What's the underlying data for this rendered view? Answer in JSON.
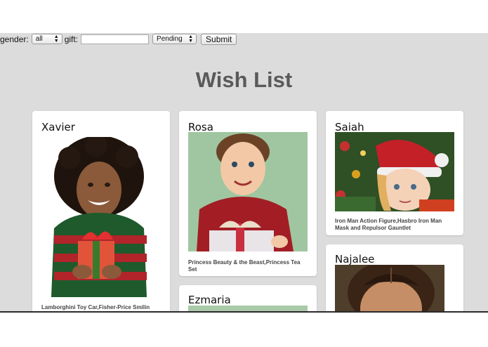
{
  "filters": {
    "gender_label": "gender:",
    "gender_value": "all",
    "gift_label": "gift:",
    "gift_value": "",
    "status_value": "Pending",
    "submit_label": "Submit"
  },
  "title": "Wish List",
  "cards": [
    {
      "name": "Xavier",
      "gifts": "Lamborghini Toy Car,Fisher-Price Smilin"
    },
    {
      "name": "Rosa",
      "gifts": "Princess Beauty & the Beast,Princess Tea Set"
    },
    {
      "name": "Saiah",
      "gifts": "Iron Man Action Figure,Hasbro Iron Man Mask and Repulsor Gauntlet"
    },
    {
      "name": "Ezmaria",
      "gifts": ""
    },
    {
      "name": "Najalee",
      "gifts": ""
    }
  ],
  "colors": {
    "background": "#dcdcdc",
    "title": "#5a5a5a",
    "card": "#ffffff"
  }
}
